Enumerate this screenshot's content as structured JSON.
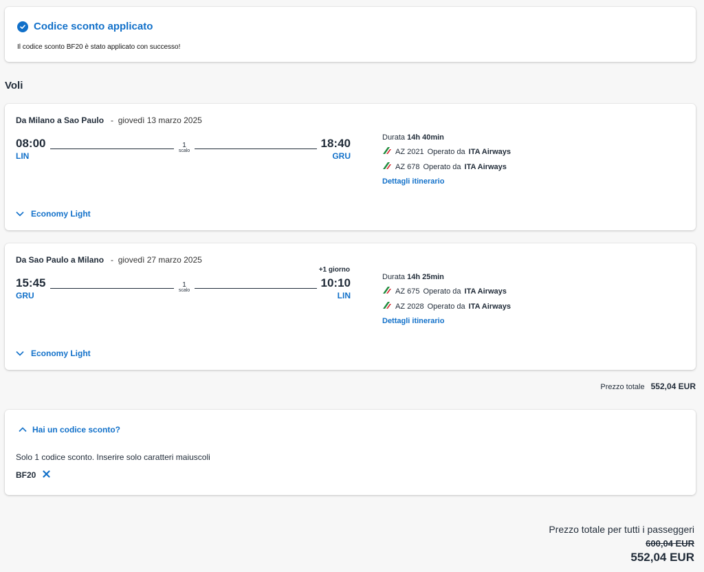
{
  "banner": {
    "title": "Codice sconto applicato",
    "message": "Il codice sconto BF20 è stato applicato con successo!"
  },
  "section_title": "Voli",
  "flights": [
    {
      "route": "Da Milano a Sao Paulo",
      "separator": "-",
      "date": "giovedì 13 marzo 2025",
      "dep_time": "08:00",
      "dep_code": "LIN",
      "arr_time": "18:40",
      "arr_code": "GRU",
      "plus_day": "",
      "stops_count": "1",
      "stops_label": "scalo",
      "duration_label": "Durata",
      "duration": "14h 40min",
      "segments": [
        {
          "flight": "AZ 2021",
          "operated_by": "Operato da",
          "carrier": "ITA Airways"
        },
        {
          "flight": "AZ 678",
          "operated_by": "Operato da",
          "carrier": "ITA Airways"
        }
      ],
      "itinerary_link": "Dettagli itinerario",
      "cabin": "Economy Light"
    },
    {
      "route": "Da Sao Paulo a Milano",
      "separator": "-",
      "date": "giovedì 27 marzo 2025",
      "dep_time": "15:45",
      "dep_code": "GRU",
      "arr_time": "10:10",
      "arr_code": "LIN",
      "plus_day": "+1 giorno",
      "stops_count": "1",
      "stops_label": "scalo",
      "duration_label": "Durata",
      "duration": "14h 25min",
      "segments": [
        {
          "flight": "AZ 675",
          "operated_by": "Operato da",
          "carrier": "ITA Airways"
        },
        {
          "flight": "AZ 2028",
          "operated_by": "Operato da",
          "carrier": "ITA Airways"
        }
      ],
      "itinerary_link": "Dettagli itinerario",
      "cabin": "Economy Light"
    }
  ],
  "price_total": {
    "label": "Prezzo totale",
    "amount": "552,04 EUR"
  },
  "discount": {
    "toggle_label": "Hai un codice sconto?",
    "hint": "Solo 1 codice sconto. Inserire solo caratteri maiuscoli",
    "code": "BF20"
  },
  "grand_total": {
    "label": "Prezzo totale per tutti i passeggeri",
    "old_amount": "600,04 EUR",
    "new_amount": "552,04 EUR"
  },
  "colors": {
    "accent": "#1170c9",
    "text": "#1f2a37",
    "ita_green": "#1e8a3c",
    "ita_red": "#d7262d"
  },
  "icons": [
    "check-circle-icon",
    "ita-airways-logo-icon",
    "chevron-down-icon",
    "chevron-up-icon",
    "close-icon"
  ]
}
